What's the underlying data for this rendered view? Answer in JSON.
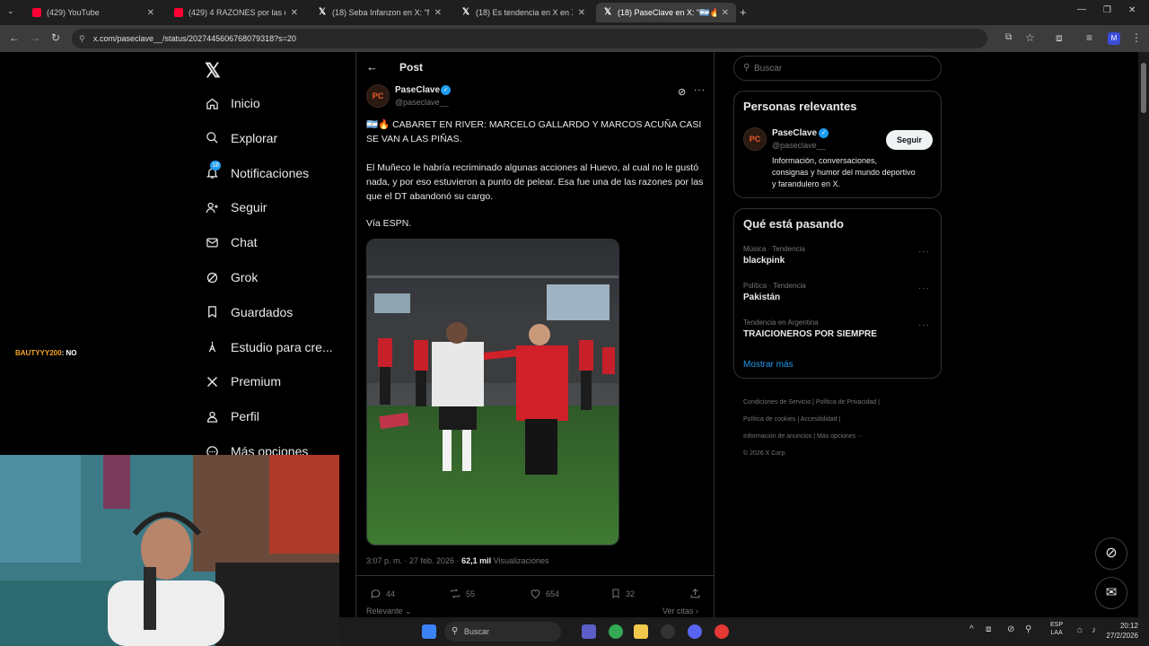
{
  "browser": {
    "tabs": [
      {
        "label": "(429) YouTube",
        "icon": "youtube-icon"
      },
      {
        "label": "(429) 4 RAZONES por las que A",
        "icon": "youtube-icon"
      },
      {
        "label": "(18) Seba Infanzon en X: \"Marc",
        "icon": "x-icon"
      },
      {
        "label": "(18) Es tendencia en X en X: \"M",
        "icon": "x-icon"
      },
      {
        "label": "(18) PaseClave en X: \"🇦🇷🔥 CAB",
        "icon": "x-icon"
      }
    ],
    "new_tab": "+",
    "url": "x.com/paseclave__/status/2027445606768079318?s=20"
  },
  "nav": {
    "items": [
      {
        "label": "Inicio",
        "icon": "home-icon"
      },
      {
        "label": "Explorar",
        "icon": "search-icon"
      },
      {
        "label": "Notificaciones",
        "icon": "bell-icon",
        "badge": "18"
      },
      {
        "label": "Seguir",
        "icon": "follow-icon"
      },
      {
        "label": "Chat",
        "icon": "mail-icon"
      },
      {
        "label": "Grok",
        "icon": "grok-icon"
      },
      {
        "label": "Guardados",
        "icon": "bookmark-icon"
      },
      {
        "label": "Estudio para cre...",
        "icon": "studio-icon"
      },
      {
        "label": "Premium",
        "icon": "x-icon"
      },
      {
        "label": "Perfil",
        "icon": "profile-icon"
      },
      {
        "label": "Más opciones",
        "icon": "more-icon"
      }
    ]
  },
  "overlay_chat": {
    "user": "BAUTYYY200",
    "message": ": NO"
  },
  "post": {
    "header_title": "Post",
    "author_name": "PaseClave",
    "author_handle": "@paseclave__",
    "avatar_text": "PC",
    "headline": "🇦🇷🔥 CABARET EN RIVER: MARCELO GALLARDO Y MARCOS ACUÑA CASI SE VAN A LAS PIÑAS.",
    "body": "El Muñeco le habría recriminado algunas acciones al Huevo, al cual no le gustó nada, y por eso estuvieron a punto de pelear. Esa fue una de las razones por las que el DT abandonó su cargo.",
    "source": "Vía ESPN.",
    "timestamp": "3:07 p. m. · 27 feb. 2026 ·",
    "views_count": "62,1 mil",
    "views_label": "Visualizaciones",
    "replies": "44",
    "reposts": "55",
    "likes": "654",
    "bookmarks": "32",
    "sort_label": "Relevante",
    "citations_label": "Ver citas"
  },
  "right": {
    "search_placeholder": "Buscar",
    "relevant_title": "Personas relevantes",
    "person_name": "PaseClave",
    "person_handle": "@paseclave__",
    "person_bio": "Información, conversaciones, consignas y humor del mundo deportivo y farandulero en X.",
    "follow_label": "Seguir",
    "trends_title": "Qué está pasando",
    "trends": [
      {
        "meta": "Música · Tendencia",
        "name": "blackpink"
      },
      {
        "meta": "Política · Tendencia",
        "name": "Pakistán"
      },
      {
        "meta": "Tendencia en Argentina",
        "name": "TRAICIONEROS POR SIEMPRE"
      }
    ],
    "more_label": "Mostrar más",
    "footer": [
      "Condiciones de Servicio",
      "Política de Privacidad",
      "Política de cookies",
      "Accesibilidad",
      "Información de anuncios",
      "Más opciones ···",
      "© 2026 X Corp."
    ]
  },
  "taskbar": {
    "search_placeholder": "Buscar",
    "lang1": "ESP",
    "lang2": "LAA",
    "time": "20:12",
    "date": "27/2/2026"
  },
  "colors": {
    "accent": "#1d9bf0",
    "background": "#000000",
    "border": "#2f3336",
    "muted": "#71767b"
  }
}
